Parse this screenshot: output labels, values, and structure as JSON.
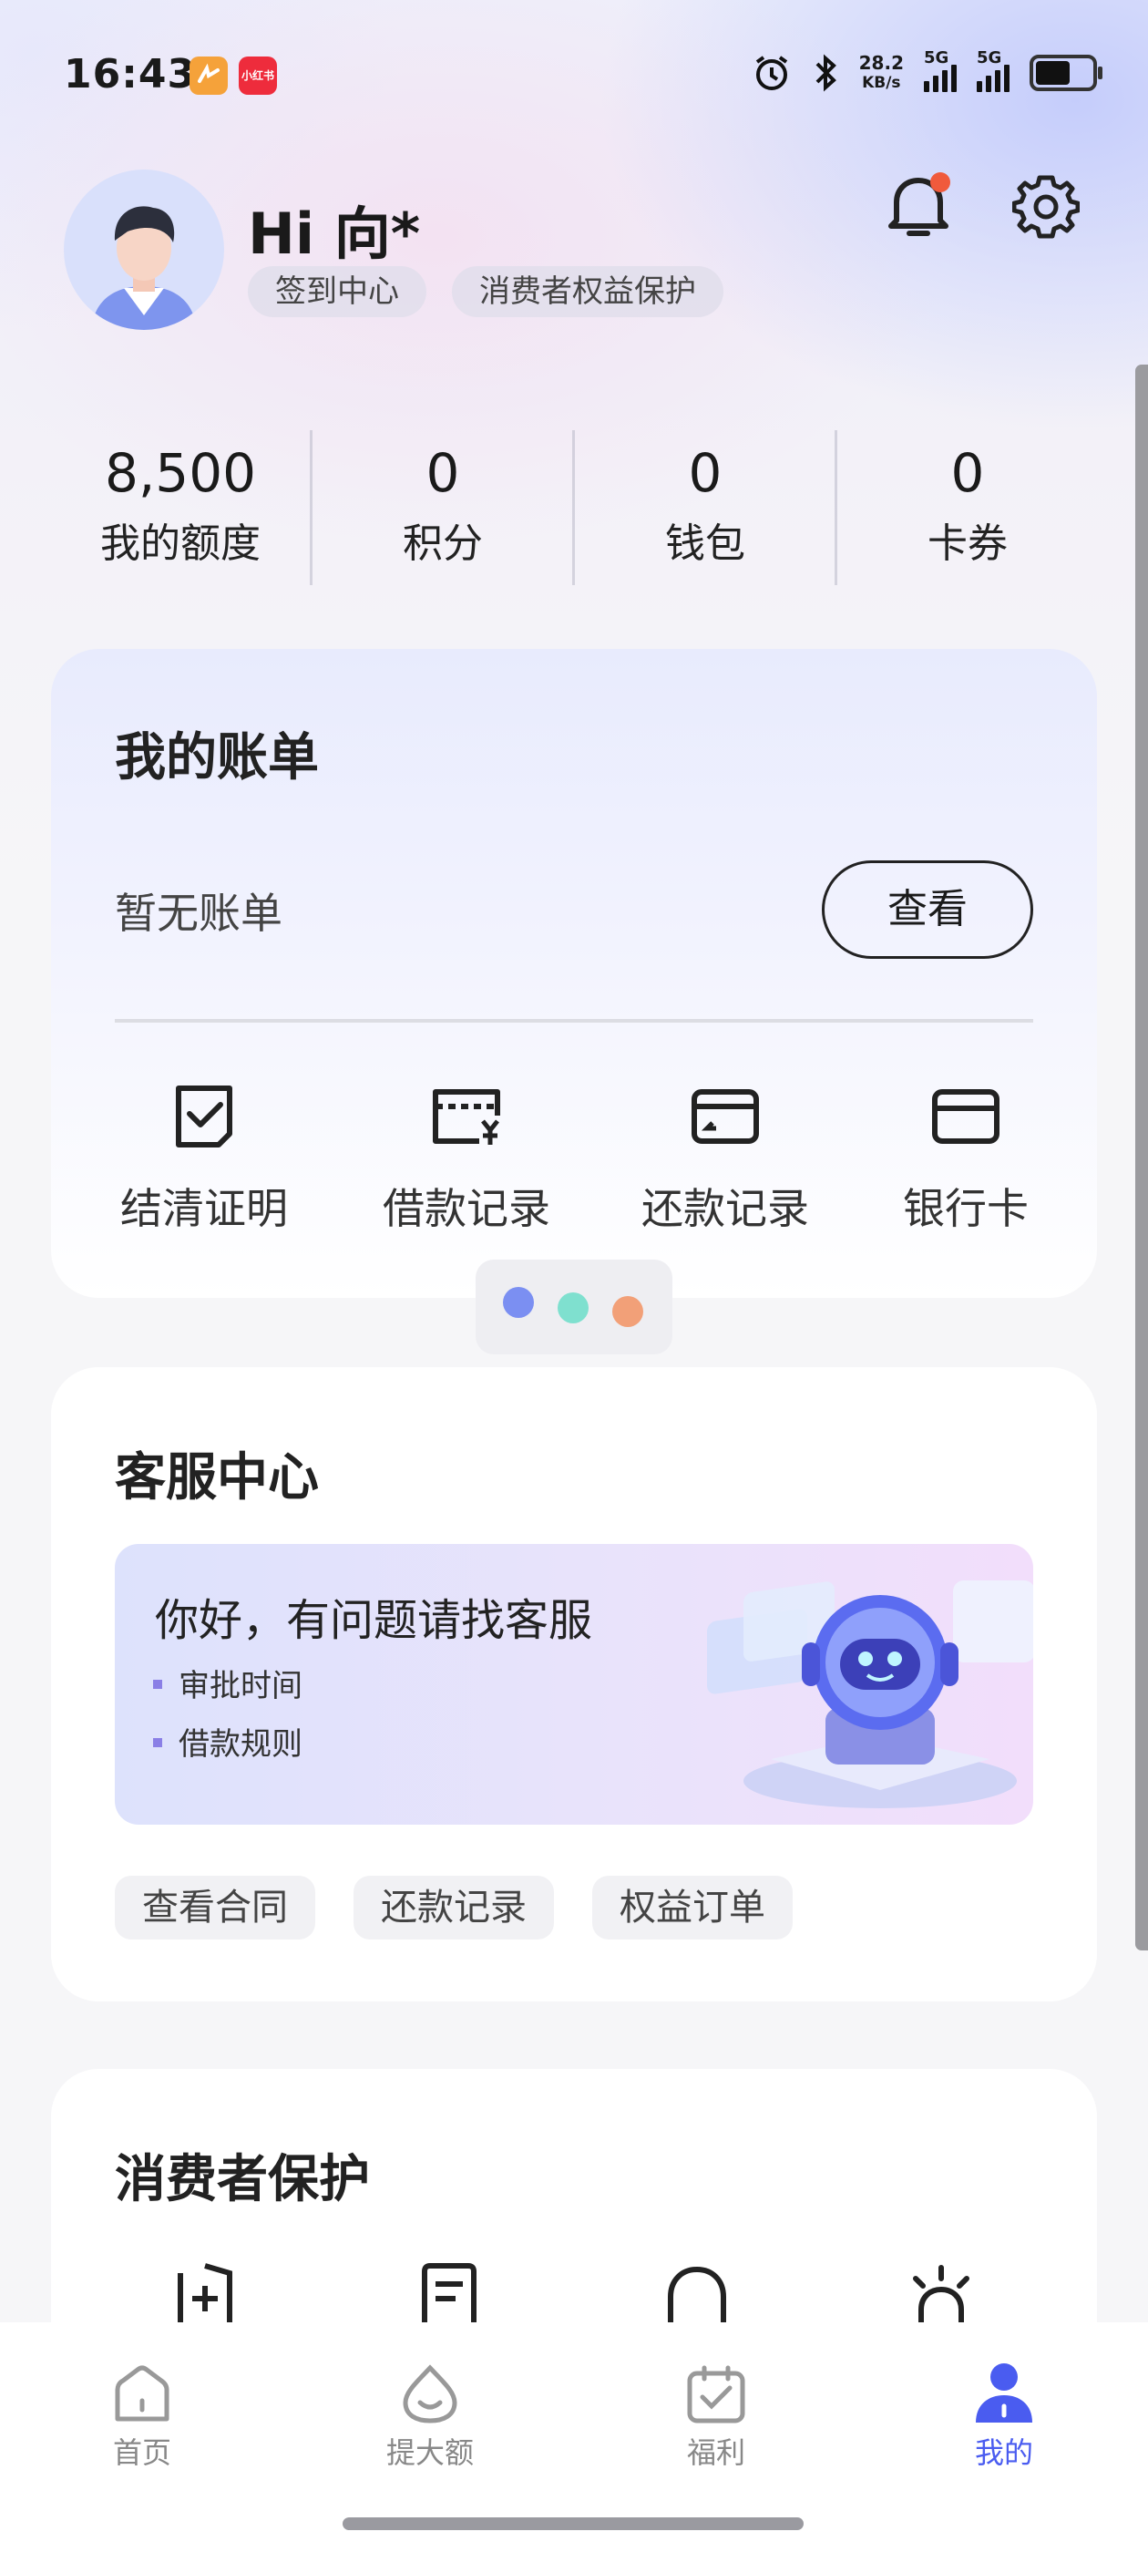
{
  "status_bar": {
    "time": "16:43",
    "app_icon_2": "小红书",
    "net_speed": "28.2",
    "net_unit": "KB/s",
    "sim1": "5G",
    "sim2": "5G",
    "icons": [
      "alarm-icon",
      "bluetooth-icon",
      "signal-icon",
      "battery-icon"
    ]
  },
  "profile": {
    "greeting": "Hi 向*",
    "chip_signin": "签到中心",
    "chip_rights": "消费者权益保护",
    "notification_dot_color": "#f05a3c"
  },
  "stats": [
    {
      "value": "8,500",
      "label": "我的额度"
    },
    {
      "value": "0",
      "label": "积分"
    },
    {
      "value": "0",
      "label": "钱包"
    },
    {
      "value": "0",
      "label": "卡券"
    }
  ],
  "bill": {
    "title": "我的账单",
    "empty_text": "暂无账单",
    "view_button": "查看",
    "quick_links": [
      {
        "label": "结清证明",
        "icon": "certificate-icon"
      },
      {
        "label": "借款记录",
        "icon": "loan-record-icon"
      },
      {
        "label": "还款记录",
        "icon": "repay-record-icon"
      },
      {
        "label": "银行卡",
        "icon": "bank-card-icon"
      }
    ]
  },
  "carousel": {
    "dot_colors": [
      "#7b8ff2",
      "#7fe0cf",
      "#f2a078"
    ]
  },
  "service": {
    "title": "客服中心",
    "banner_title": "你好，有问题请找客服",
    "bullets": [
      "审批时间",
      "借款规则"
    ],
    "tags": [
      "查看合同",
      "还款记录",
      "权益订单"
    ]
  },
  "protection": {
    "title": "消费者保护",
    "icons": [
      "shield-plus-icon",
      "document-icon",
      "bell-icon",
      "light-icon"
    ]
  },
  "tabbar": {
    "items": [
      {
        "label": "首页",
        "icon": "home-icon"
      },
      {
        "label": "提大额",
        "icon": "smile-icon"
      },
      {
        "label": "福利",
        "icon": "calendar-check-icon"
      },
      {
        "label": "我的",
        "icon": "user-icon"
      }
    ],
    "active_index": 3,
    "active_color": "#4a5cf0"
  }
}
